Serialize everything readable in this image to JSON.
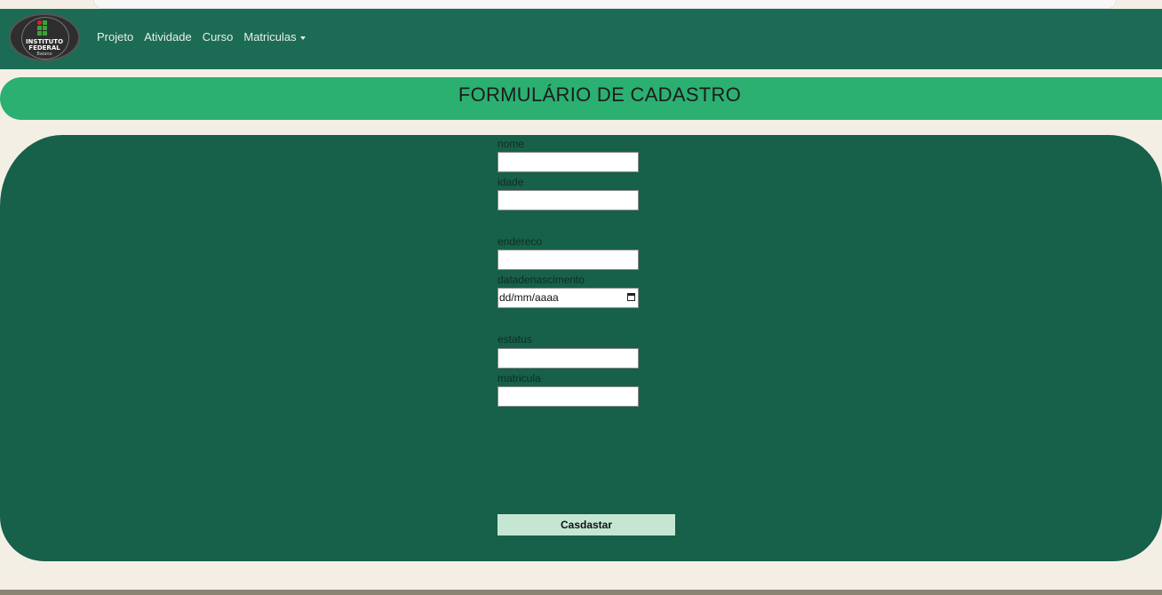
{
  "logo": {
    "line1": "INSTITUTO",
    "line2": "FEDERAL",
    "line3": "Baiano"
  },
  "nav": {
    "items": [
      {
        "label": "Projeto"
      },
      {
        "label": "Atividade"
      },
      {
        "label": "Curso"
      },
      {
        "label": "Matriculas"
      }
    ]
  },
  "page": {
    "title": "FORMULÁRIO DE CADASTRO"
  },
  "form": {
    "nome_label": "nome",
    "nome_value": "",
    "idade_label": "idade",
    "idade_value": "",
    "endereco_label": "endereco",
    "endereco_value": "",
    "datadenascimento_label": "datadenascimento",
    "datadenascimento_placeholder": "dd/mm/aaaa",
    "estatus_label": "estatus",
    "estatus_value": "",
    "matricula_label": "matricula",
    "matricula_value": "",
    "submit_label": "Casdastar"
  },
  "colors": {
    "navbar": "#1c6b55",
    "title_bar": "#2bb072",
    "form_panel": "#17604a",
    "submit_button": "#c5e6d3",
    "page_background": "#f4efe5"
  },
  "icons": {
    "logo": "instituto-federal-logo",
    "nav_dropdown": "caret-down-icon",
    "date_picker": "calendar-icon"
  }
}
